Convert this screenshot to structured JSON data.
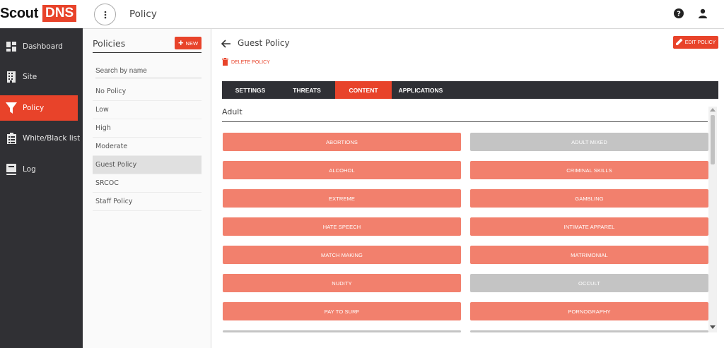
{
  "app": {
    "logo_scout": "Scout",
    "logo_dns": "DNS"
  },
  "sidebar": {
    "items": [
      {
        "label": "Dashboard",
        "icon": "dashboard-icon"
      },
      {
        "label": "Site",
        "icon": "building-icon"
      },
      {
        "label": "Policy",
        "icon": "filter-icon",
        "active": true
      },
      {
        "label": "White/Black list",
        "icon": "clipboard-icon"
      },
      {
        "label": "Log",
        "icon": "book-icon"
      }
    ]
  },
  "topbar": {
    "title": "Policy",
    "help_icon": "help-circle-icon",
    "user_icon": "user-icon"
  },
  "policies": {
    "title": "Policies",
    "new_label": "NEW",
    "search_placeholder": "Search by name",
    "items": [
      "No Policy",
      "Low",
      "High",
      "Moderate",
      "Guest Policy",
      "SRCOC",
      "Staff Policy"
    ],
    "selected": "Guest Policy"
  },
  "main": {
    "policy_title": "Guest Policy",
    "edit_label": "EDIT POLICY",
    "delete_label": "DELETE POLICY",
    "tabs": [
      {
        "label": "SETTINGS"
      },
      {
        "label": "THREATS"
      },
      {
        "label": "CONTENT",
        "active": true
      },
      {
        "label": "APPLICATIONS"
      }
    ],
    "section_title": "Adult",
    "categories": [
      {
        "label": "ABORTIONS",
        "blocked": true
      },
      {
        "label": "ADULT MIXED",
        "blocked": false
      },
      {
        "label": "ALCOHOL",
        "blocked": true
      },
      {
        "label": "CRIMINAL SKILLS",
        "blocked": true
      },
      {
        "label": "EXTREME",
        "blocked": true
      },
      {
        "label": "GAMBLING",
        "blocked": true
      },
      {
        "label": "HATE SPEECH",
        "blocked": true
      },
      {
        "label": "INTIMATE APPAREL",
        "blocked": true
      },
      {
        "label": "MATCH MAKING",
        "blocked": true
      },
      {
        "label": "MATRIMONIAL",
        "blocked": true
      },
      {
        "label": "NUDITY",
        "blocked": true
      },
      {
        "label": "OCCULT",
        "blocked": false
      },
      {
        "label": "PAY TO SURF",
        "blocked": true
      },
      {
        "label": "PORNOGRAPHY",
        "blocked": true
      }
    ]
  },
  "colors": {
    "accent": "#e8432a",
    "category_on": "#f2806d",
    "category_off": "#c4c4c4",
    "sidebar_bg": "#303034",
    "tabbar_bg": "#2f3035"
  }
}
